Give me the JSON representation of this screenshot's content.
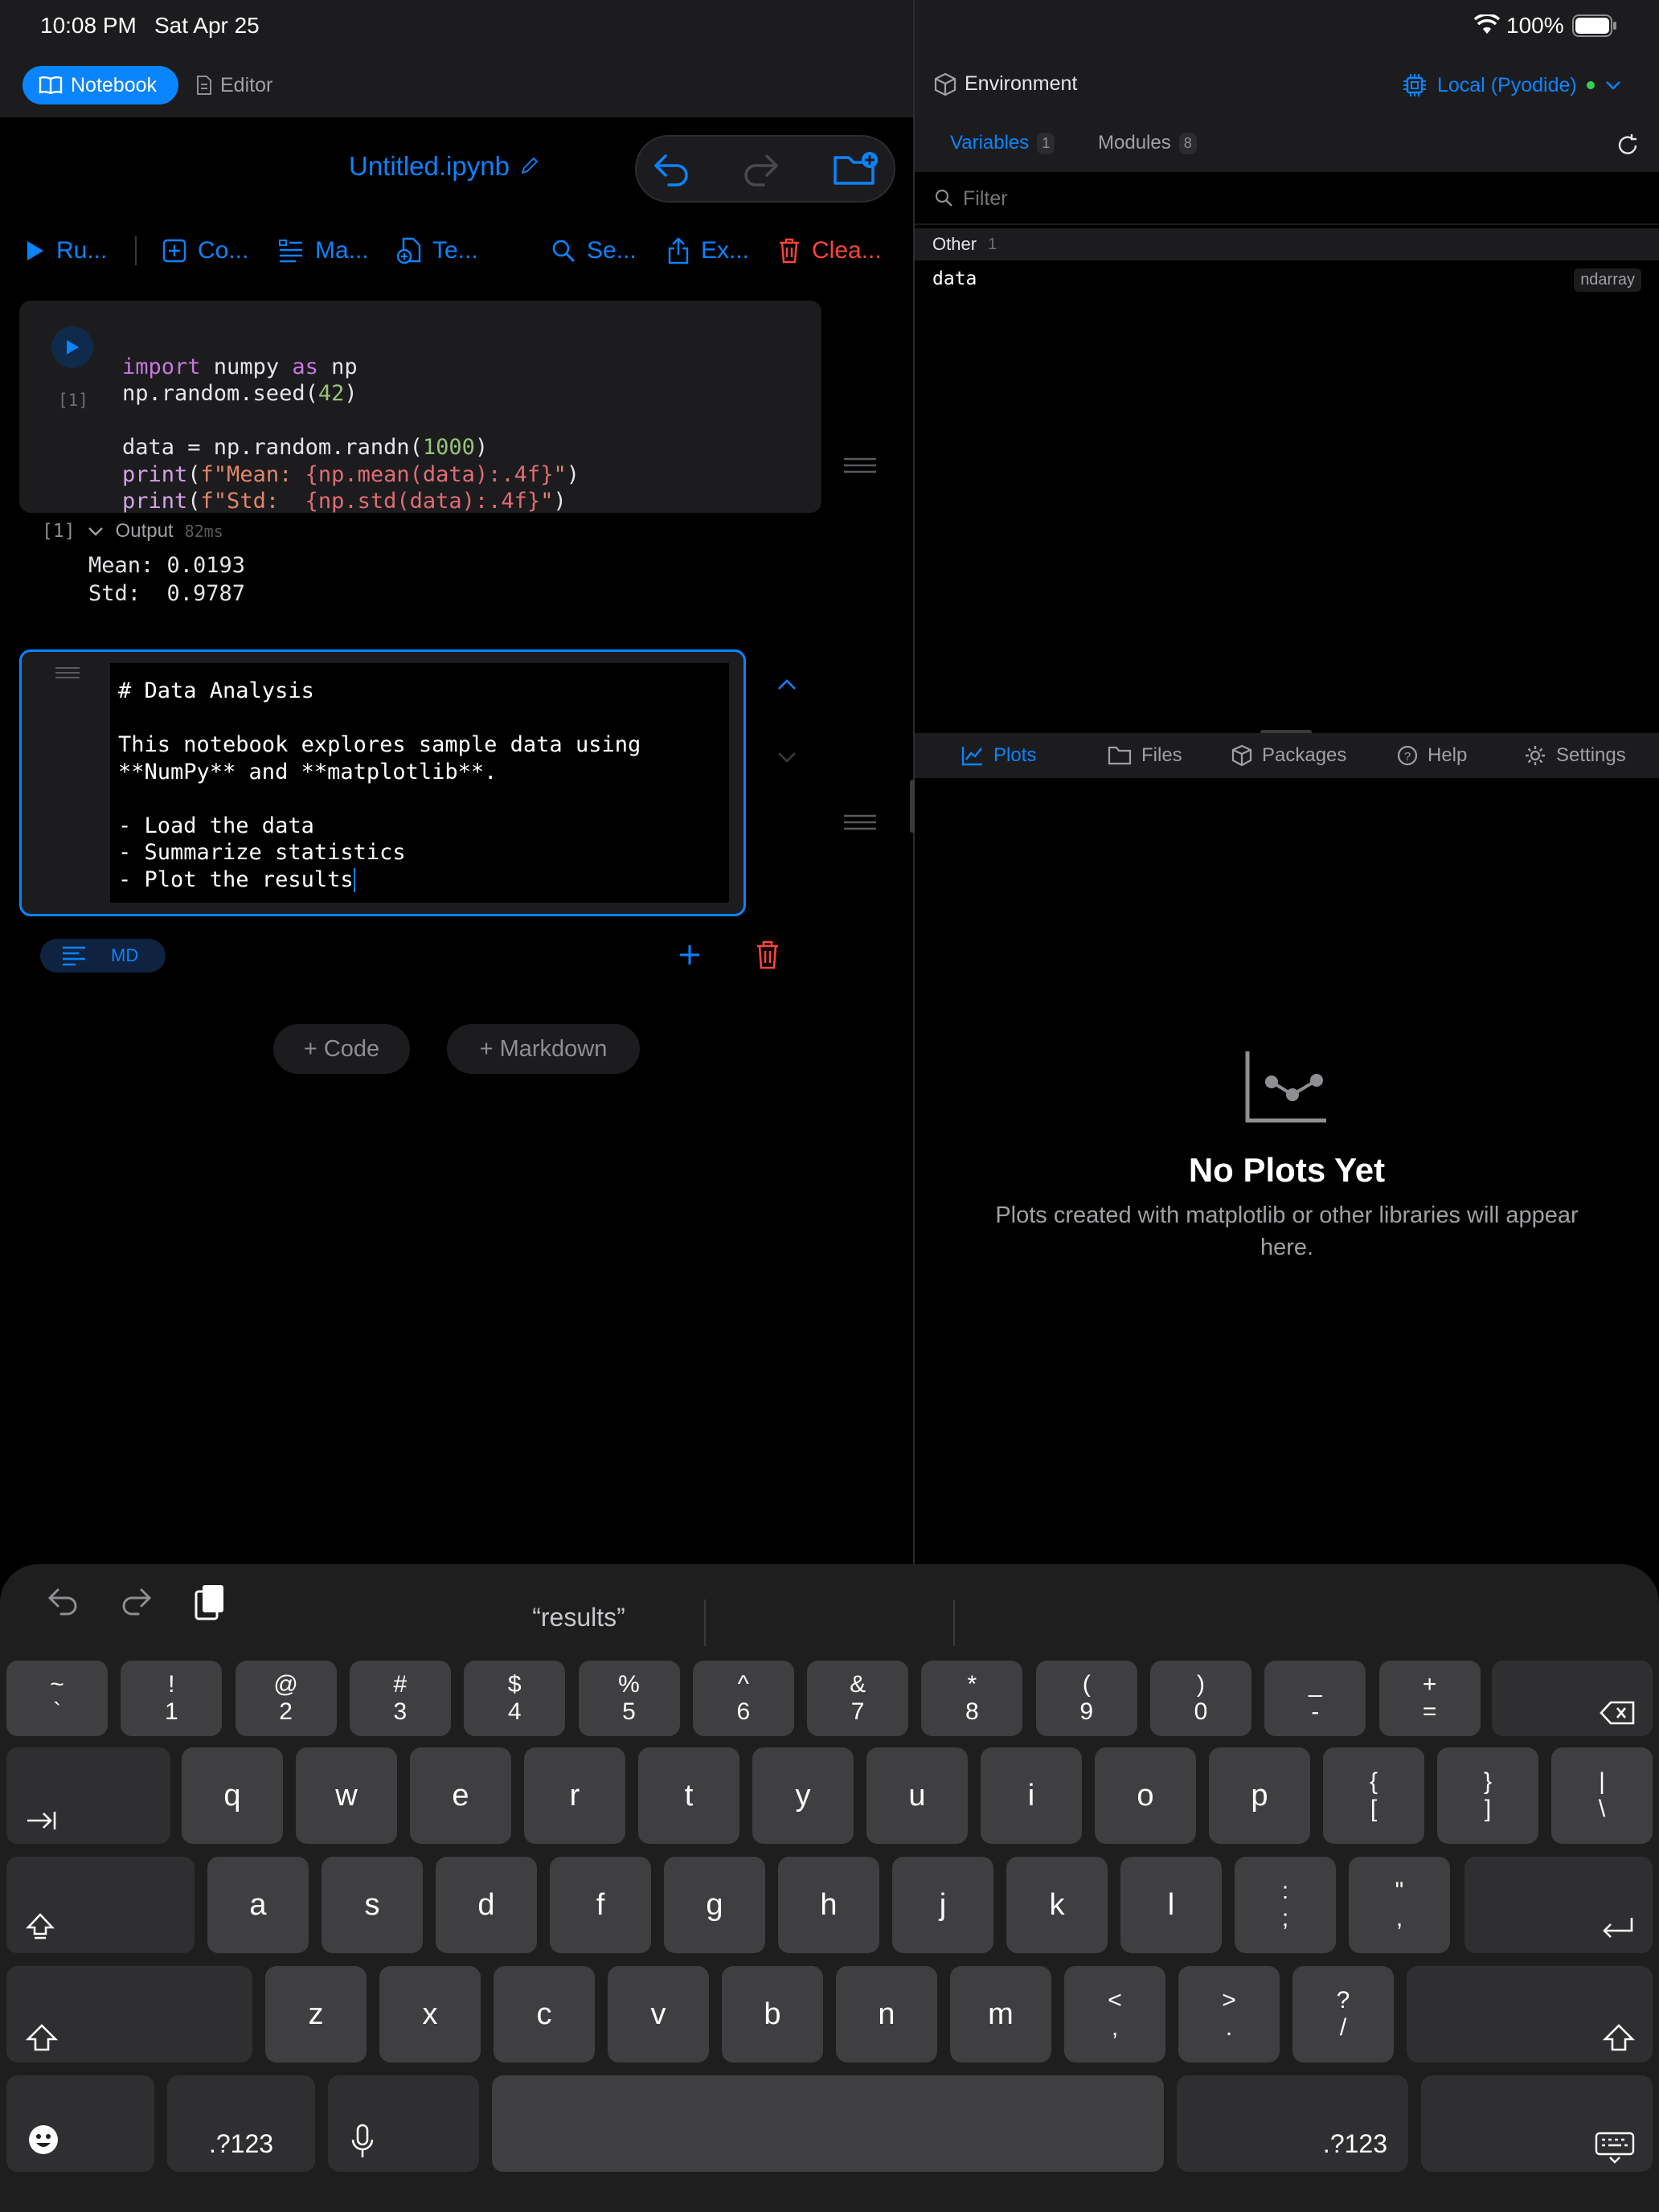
{
  "status": {
    "time": "10:08 PM",
    "date": "Sat Apr 25",
    "battery": "100%"
  },
  "modes": {
    "notebook": "Notebook",
    "editor": "Editor"
  },
  "notebook": {
    "filename": "Untitled.ipynb"
  },
  "toolbar": {
    "run": "Ru...",
    "code": "Co...",
    "markdown": "Ma...",
    "template": "Te...",
    "search": "Se...",
    "export": "Ex...",
    "clear": "Clea..."
  },
  "cell1": {
    "exec_count": "[1]",
    "lines": [
      "import numpy as np",
      "np.random.seed(42)",
      "",
      "data = np.random.randn(1000)",
      "print(f\"Mean: {np.mean(data):.4f}\")",
      "print(f\"Std:  {np.std(data):.4f}\")"
    ]
  },
  "output": {
    "count": "[1]",
    "label": "Output",
    "time": "82ms",
    "lines": [
      "Mean: 0.0193",
      "Std:  0.9787"
    ]
  },
  "md_cell": {
    "text": "# Data Analysis\n\nThis notebook explores sample data using\n**NumPy** and **matplotlib**.\n\n- Load the data\n- Summarize statistics\n- Plot the results",
    "type_label": "MD"
  },
  "add": {
    "code": "+ Code",
    "markdown": "+ Markdown"
  },
  "env": {
    "title": "Environment",
    "runtime": "Local (Pyodide)",
    "tabs": {
      "variables": "Variables",
      "variables_count": "1",
      "modules": "Modules",
      "modules_count": "8"
    },
    "filter_placeholder": "Filter",
    "group": "Other",
    "group_count": "1",
    "vars": [
      {
        "name": "data",
        "type": "ndarray"
      }
    ]
  },
  "bottom_tabs": {
    "plots": "Plots",
    "files": "Files",
    "packages": "Packages",
    "help": "Help",
    "settings": "Settings"
  },
  "plots_empty": {
    "title": "No Plots Yet",
    "desc": "Plots created with matplotlib or other libraries will appear here."
  },
  "keyboard": {
    "suggestion": "“results”",
    "row1": [
      [
        "~",
        "`"
      ],
      [
        "!",
        "1"
      ],
      [
        "@",
        "2"
      ],
      [
        "#",
        "3"
      ],
      [
        "$",
        "4"
      ],
      [
        "%",
        "5"
      ],
      [
        "^",
        "6"
      ],
      [
        "&",
        "7"
      ],
      [
        "*",
        "8"
      ],
      [
        "(",
        "9"
      ],
      [
        ")",
        "0"
      ],
      [
        "_",
        "-"
      ],
      [
        "+",
        "="
      ]
    ],
    "row2": [
      "q",
      "w",
      "e",
      "r",
      "t",
      "y",
      "u",
      "i",
      "o",
      "p"
    ],
    "row2b": [
      [
        "{",
        "["
      ],
      [
        "}",
        "]"
      ],
      [
        "|",
        "\\"
      ]
    ],
    "row3": [
      "a",
      "s",
      "d",
      "f",
      "g",
      "h",
      "j",
      "k",
      "l"
    ],
    "row3b": [
      [
        ":",
        ";"
      ],
      [
        "\"",
        ","
      ]
    ],
    "row4": [
      "z",
      "x",
      "c",
      "v",
      "b",
      "n",
      "m"
    ],
    "row4b": [
      [
        "<",
        ","
      ],
      [
        ">",
        "."
      ],
      [
        "?",
        "/"
      ]
    ],
    "numkey": ".?123"
  },
  "colors": {
    "accent": "#0a84ff",
    "danger": "#ff453a",
    "green": "#30d158"
  }
}
